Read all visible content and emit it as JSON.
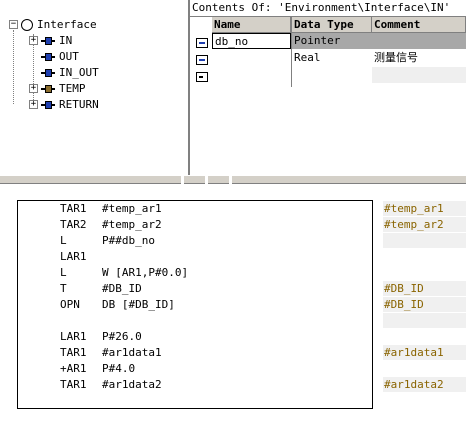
{
  "tree": {
    "root": "Interface",
    "items": [
      {
        "label": "IN",
        "toggle": "+"
      },
      {
        "label": "OUT",
        "toggle": ""
      },
      {
        "label": "IN_OUT",
        "toggle": ""
      },
      {
        "label": "TEMP",
        "toggle": "+"
      },
      {
        "label": "RETURN",
        "toggle": "+"
      }
    ]
  },
  "detail": {
    "contents_of": "Contents Of: 'Environment\\Interface\\IN'",
    "columns": [
      "Name",
      "Data Type",
      "Comment"
    ],
    "rows": [
      {
        "name": "db_no",
        "type": "Pointer",
        "comment": ""
      },
      {
        "name": "",
        "type": "Real",
        "comment": "测量信号"
      },
      {
        "name": "",
        "type": "",
        "comment": ""
      }
    ]
  },
  "code": {
    "lines": [
      {
        "op": "TAR1",
        "arg": "#temp_ar1"
      },
      {
        "op": "TAR2",
        "arg": "#temp_ar2"
      },
      {
        "op": "L",
        "arg": "P##db_no"
      },
      {
        "op": "LAR1",
        "arg": ""
      },
      {
        "op": "L",
        "arg": "W [AR1,P#0.0]"
      },
      {
        "op": "T",
        "arg": "#DB_ID"
      },
      {
        "op": "OPN",
        "arg": "DB [#DB_ID]"
      },
      {
        "op": "",
        "arg": ""
      },
      {
        "op": "LAR1",
        "arg": "P#26.0"
      },
      {
        "op": "TAR1",
        "arg": "#ar1data1"
      },
      {
        "op": "+AR1",
        "arg": "P#4.0"
      },
      {
        "op": "TAR1",
        "arg": "#ar1data2"
      }
    ],
    "comments": [
      "#temp_ar1",
      "#temp_ar2",
      "#DB_ID",
      "#DB_ID",
      "#ar1data1",
      "#ar1data2"
    ]
  }
}
